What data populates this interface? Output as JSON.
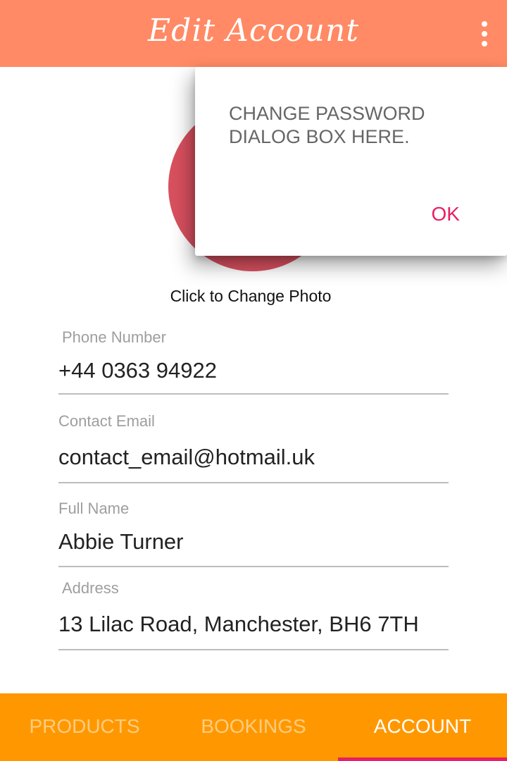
{
  "app_bar": {
    "title": "Edit Account",
    "overflow_icon": "more-vert-icon"
  },
  "profile": {
    "change_photo_label": "Click to Change Photo",
    "avatar_color": "#d9505f"
  },
  "fields": {
    "phone": {
      "label": "Phone Number",
      "value": "+44 0363 94922"
    },
    "email": {
      "label": "Contact Email",
      "value": "contact_email@hotmail.uk"
    },
    "name": {
      "label": "Full Name",
      "value": "Abbie Turner"
    },
    "address": {
      "label": "Address",
      "value": "13 Lilac Road, Manchester, BH6 7TH"
    }
  },
  "bottom_nav": {
    "tabs": [
      {
        "label": "PRODUCTS",
        "active": false
      },
      {
        "label": "BOOKINGS",
        "active": false
      },
      {
        "label": "ACCOUNT",
        "active": true
      }
    ]
  },
  "dialog": {
    "message": "CHANGE PASSWORD DIALOG BOX HERE.",
    "ok_label": "OK"
  },
  "colors": {
    "app_bar": "#ff8a65",
    "bottom_nav": "#ff9800",
    "accent": "#e91e63",
    "inactive_tab_text": "#ffcc80"
  }
}
